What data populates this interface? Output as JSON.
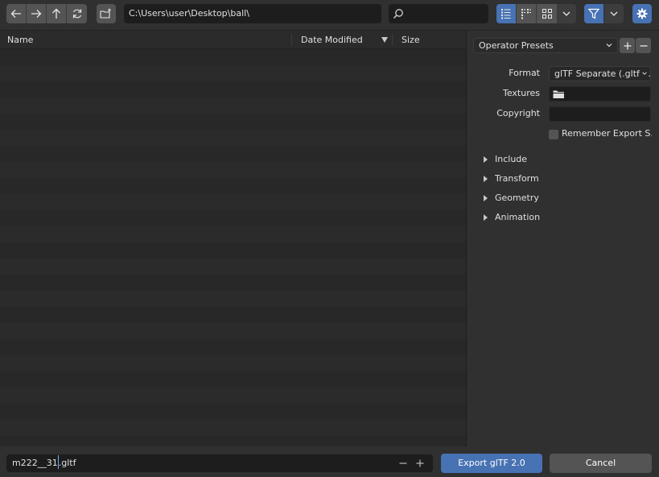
{
  "toolbar": {
    "path": "C:\\Users\\user\\Desktop\\ball\\",
    "search_placeholder": ""
  },
  "filelist": {
    "columns": [
      "Name",
      "Date Modified",
      "Size"
    ],
    "row_count": 25
  },
  "sidebar": {
    "presets_label": "Operator Presets",
    "format_label": "Format",
    "format_value": "glTF Separate (.gltf ...",
    "textures_label": "Textures",
    "textures_value": "",
    "copyright_label": "Copyright",
    "copyright_value": "",
    "remember_label": "Remember Export S...",
    "sections": [
      "Include",
      "Transform",
      "Geometry",
      "Animation"
    ]
  },
  "bottom": {
    "filename_before_caret": "m222__31",
    "filename_after_caret": ".gltf",
    "export_label": "Export glTF 2.0",
    "cancel_label": "Cancel"
  },
  "colors": {
    "accent": "#4772b3",
    "background": "#303030",
    "field": "#1d1d1d"
  },
  "icons": [
    "back-icon",
    "forward-icon",
    "parent-directory-icon",
    "refresh-icon",
    "new-folder-icon",
    "search-icon",
    "list-view-icon",
    "short-list-icon",
    "thumbnail-view-icon",
    "chevron-down-icon",
    "filter-icon",
    "settings-gear-icon",
    "folder-icon",
    "plus-icon",
    "minus-icon"
  ]
}
